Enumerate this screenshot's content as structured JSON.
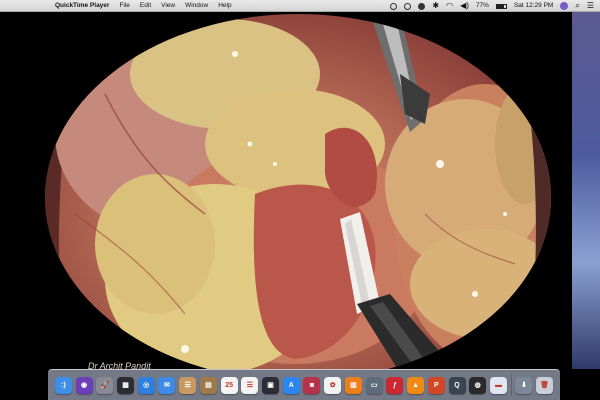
{
  "menubar": {
    "apple_glyph": "",
    "app_name": "QuickTime Player",
    "menus": [
      "File",
      "Edit",
      "View",
      "Window",
      "Help"
    ],
    "battery_text": "77%",
    "battery_level": 0.77,
    "clock": "Sat 12:29 PM"
  },
  "video": {
    "watermark": "Dr Archit Pandit"
  },
  "dock": {
    "icons": [
      {
        "name": "finder-icon",
        "color": "#3c8ee6",
        "glyph": ":)"
      },
      {
        "name": "siri-icon",
        "color": "#6b3fb8",
        "glyph": "◉"
      },
      {
        "name": "launchpad-icon",
        "color": "#8a8a95",
        "glyph": "🚀"
      },
      {
        "name": "mission-control-icon",
        "color": "#2c2c34",
        "glyph": "▦"
      },
      {
        "name": "safari-icon",
        "color": "#2e7fe0",
        "glyph": "◎"
      },
      {
        "name": "mail-icon",
        "color": "#3d8be6",
        "glyph": "✉"
      },
      {
        "name": "contacts-icon",
        "color": "#c89a62",
        "glyph": "☰"
      },
      {
        "name": "notes-icon",
        "color": "#9d7a46",
        "glyph": "▤"
      },
      {
        "name": "calendar-icon",
        "color": "#f4f4f4",
        "glyph": "25"
      },
      {
        "name": "reminders-icon",
        "color": "#f4f4f4",
        "glyph": "☰"
      },
      {
        "name": "stickies-icon",
        "color": "#2c2c34",
        "glyph": "▣"
      },
      {
        "name": "app-store-icon",
        "color": "#2d86f0",
        "glyph": "A"
      },
      {
        "name": "photo-booth-icon",
        "color": "#b4334a",
        "glyph": "◙"
      },
      {
        "name": "photos-icon",
        "color": "#f2f2f2",
        "glyph": "✿"
      },
      {
        "name": "ibooks-icon",
        "color": "#ef7d1a",
        "glyph": "▥"
      },
      {
        "name": "keynote-icon",
        "color": "#5d6b7a",
        "glyph": "▭"
      },
      {
        "name": "flash-player-icon",
        "color": "#cc2833",
        "glyph": "ƒ"
      },
      {
        "name": "vlc-icon",
        "color": "#f08a14",
        "glyph": "▲"
      },
      {
        "name": "powerpoint-icon",
        "color": "#d24726",
        "glyph": "P"
      },
      {
        "name": "quicktime-icon",
        "color": "#3a4350",
        "glyph": "Q"
      },
      {
        "name": "obs-icon",
        "color": "#2a2a2a",
        "glyph": "◍"
      },
      {
        "name": "preview-icon",
        "color": "#dfe6ef",
        "glyph": "▬"
      },
      {
        "name": "downloads-folder-icon",
        "color": "#7d8897",
        "glyph": "⬇"
      },
      {
        "name": "trash-icon",
        "color": "#c9ced6",
        "glyph": "🗑"
      }
    ],
    "separator_after": 21
  }
}
